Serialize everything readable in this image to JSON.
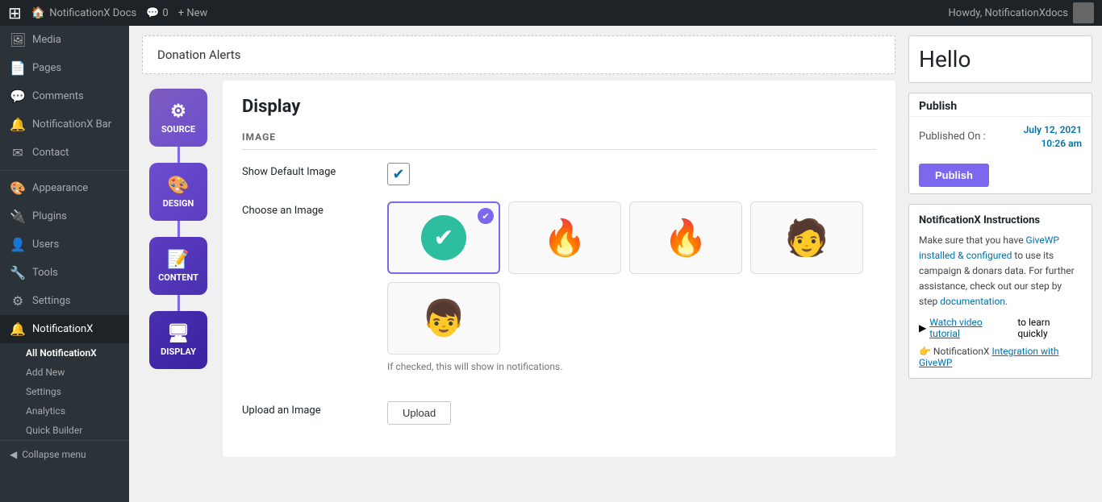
{
  "adminbar": {
    "wp_logo": "⊞",
    "site_name": "NotificationX Docs",
    "comments_icon": "💬",
    "comments_count": "0",
    "new_label": "+ New",
    "howdy": "Howdy, NotificationXdocs"
  },
  "sidebar": {
    "items": [
      {
        "label": "Media",
        "icon": "🖼"
      },
      {
        "label": "Pages",
        "icon": "📄"
      },
      {
        "label": "Comments",
        "icon": "💬"
      },
      {
        "label": "NotificationX Bar",
        "icon": "🔔"
      },
      {
        "label": "Contact",
        "icon": "✉"
      },
      {
        "label": "Appearance",
        "icon": "🎨"
      },
      {
        "label": "Plugins",
        "icon": "🔌"
      },
      {
        "label": "Users",
        "icon": "👤"
      },
      {
        "label": "Tools",
        "icon": "🔧"
      },
      {
        "label": "Settings",
        "icon": "⚙"
      },
      {
        "label": "NotificationX",
        "icon": "🔔"
      }
    ],
    "submenu": [
      {
        "label": "All NotificationX",
        "active": true
      },
      {
        "label": "Add New",
        "active": false
      },
      {
        "label": "Settings",
        "active": false
      },
      {
        "label": "Analytics",
        "active": false
      },
      {
        "label": "Quick Builder",
        "active": false
      }
    ],
    "collapse_label": "Collapse menu"
  },
  "donation_alerts": {
    "label": "Donation Alerts"
  },
  "steps": [
    {
      "label": "SOURCE",
      "icon": "⚙",
      "class": "step-source"
    },
    {
      "label": "DESIGN",
      "icon": "🎨",
      "class": "step-design"
    },
    {
      "label": "CONTENT",
      "icon": "📝",
      "class": "step-content"
    },
    {
      "label": "DISPLAY",
      "icon": "🖥",
      "class": "step-display"
    }
  ],
  "display": {
    "title": "Display",
    "section_image_label": "IMAGE",
    "show_default_image_label": "Show Default Image",
    "choose_image_label": "Choose an Image",
    "helper_text": "If checked, this will show in notifications.",
    "upload_label": "Upload an Image",
    "upload_btn_label": "Upload",
    "images": [
      {
        "type": "checkmark",
        "selected": true
      },
      {
        "type": "fire1",
        "selected": false
      },
      {
        "type": "fire2",
        "selected": false
      },
      {
        "type": "person1",
        "selected": false
      },
      {
        "type": "person2",
        "selected": false
      }
    ]
  },
  "right_sidebar": {
    "hello_text": "Hello",
    "publish_section": {
      "label": "Publish",
      "published_on_label": "Published On :",
      "published_date": "July 12, 2021",
      "published_time": "10:26 am",
      "publish_btn_label": "Publish"
    },
    "instructions": {
      "title": "NotificationX Instructions",
      "text_before_givewp": "Make sure that you have ",
      "givewp_link_text": "GiveWP installed & configured",
      "text_after_givewp": " to use its campaign & donars data. For further assistance, check out our step by step ",
      "docs_link_text": "documentation",
      "watch_video_prefix": "▶",
      "watch_video_link_text": "Watch video tutorial",
      "watch_video_suffix": " to learn quickly",
      "integration_prefix": "👉 NotificationX ",
      "integration_link_text": "Integration with GiveWP"
    }
  }
}
